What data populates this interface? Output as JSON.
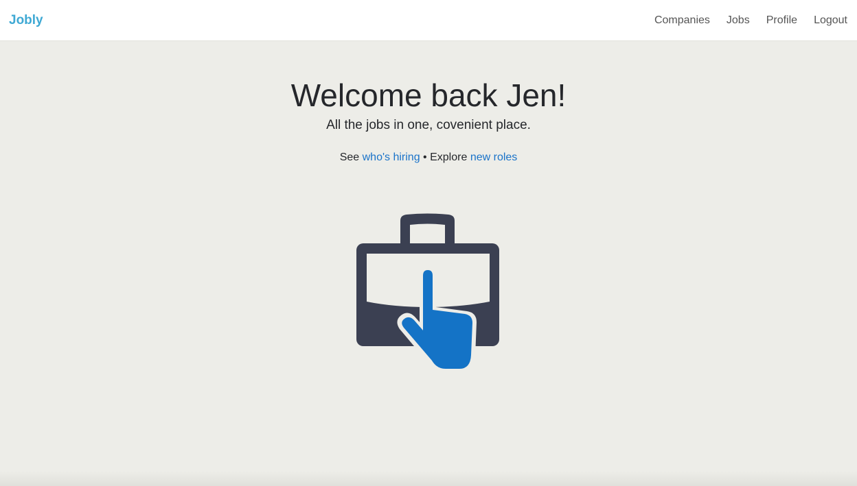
{
  "nav": {
    "brand": "Jobly",
    "links": [
      "Companies",
      "Jobs",
      "Profile",
      "Logout"
    ]
  },
  "hero": {
    "title": "Welcome back Jen!",
    "tagline": "All the jobs in one, covenient place.",
    "see_prefix": "See",
    "see_link": "who's hiring",
    "separator": "•",
    "explore_prefix": "Explore",
    "explore_link": "new roles"
  },
  "illustration": {
    "icon": "briefcase-pointing-hand-icon"
  },
  "colors": {
    "brand": "#3fa9d4",
    "link": "#1a73c9",
    "briefcase": "#3b4052",
    "hand": "#1473c6",
    "background": "#edede8",
    "navbar": "#ffffff"
  }
}
